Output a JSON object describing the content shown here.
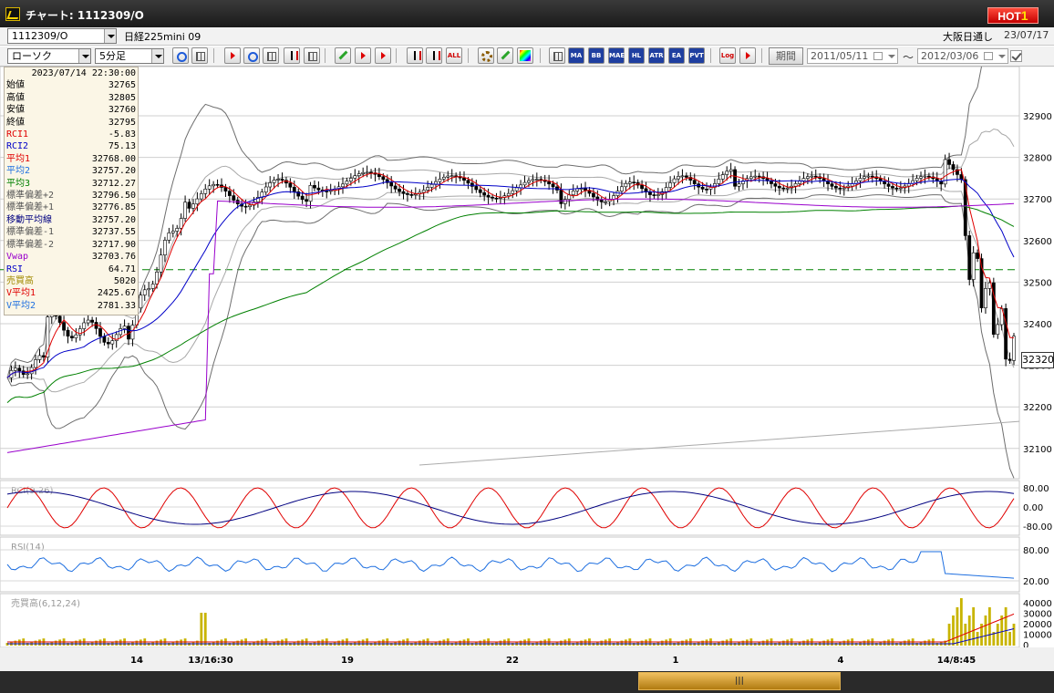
{
  "window": {
    "title": "チャート: 1112309/O",
    "hot_label": "HOT",
    "hot_num": "1"
  },
  "symbol_bar": {
    "code": "1112309/O",
    "name": "日経225mini 09",
    "exchange": "大阪日通し",
    "date": "23/07/17"
  },
  "toolbar": {
    "chart_type": "ローソク",
    "interval": "5分足",
    "buttons": [
      "MA",
      "BB",
      "MAE",
      "HL",
      "ATR",
      "EA RA",
      "PVT",
      "Log",
      "ALL"
    ],
    "period_label": "期間",
    "date_from": "2011/05/11",
    "date_to": "2012/03/06",
    "tilde": "〜"
  },
  "info_panel": {
    "timestamp": "2023/07/14 22:30:00",
    "rows": [
      {
        "label": "始値",
        "value": "32765",
        "color": "#000000"
      },
      {
        "label": "高値",
        "value": "32805",
        "color": "#000000"
      },
      {
        "label": "安値",
        "value": "32760",
        "color": "#000000"
      },
      {
        "label": "終値",
        "value": "32795",
        "color": "#000000"
      },
      {
        "label": "RCI1",
        "value": "-5.83",
        "color": "#e00000"
      },
      {
        "label": "RCI2",
        "value": "75.13",
        "color": "#0000c8"
      },
      {
        "label": "平均1",
        "value": "32768.00",
        "color": "#e00000"
      },
      {
        "label": "平均2",
        "value": "32757.20",
        "color": "#1e6fe0"
      },
      {
        "label": "平均3",
        "value": "32712.27",
        "color": "#008000"
      },
      {
        "label": "標準偏差+2",
        "value": "32796.50",
        "color": "#555555"
      },
      {
        "label": "標準偏差+1",
        "value": "32776.85",
        "color": "#555555"
      },
      {
        "label": "移動平均線",
        "value": "32757.20",
        "color": "#000080"
      },
      {
        "label": "標準偏差-1",
        "value": "32737.55",
        "color": "#555555"
      },
      {
        "label": "標準偏差-2",
        "value": "32717.90",
        "color": "#555555"
      },
      {
        "label": "Vwap",
        "value": "32703.76",
        "color": "#9900cc"
      },
      {
        "label": "RSI",
        "value": "64.71",
        "color": "#0000c8"
      },
      {
        "label": "売買高",
        "value": "5020",
        "color": "#a08a00"
      },
      {
        "label": "V平均1",
        "value": "2425.67",
        "color": "#e00000"
      },
      {
        "label": "V平均2",
        "value": "2781.33",
        "color": "#1e6fe0"
      }
    ]
  },
  "price_axis": {
    "labels": [
      "32900",
      "32800",
      "32700",
      "32600",
      "32500",
      "32400",
      "32300",
      "32200",
      "32100"
    ],
    "current": "32320"
  },
  "panels": {
    "rci": {
      "label": "RCI(9,26)",
      "ticks": [
        "80.00",
        "0.00",
        "-80.00"
      ]
    },
    "rsi": {
      "label": "RSI(14)",
      "ticks": [
        "80.00",
        "20.00"
      ]
    },
    "volume": {
      "label": "売買高(6,12,24)",
      "ticks": [
        "40000",
        "30000",
        "20000",
        "10000",
        "0"
      ]
    }
  },
  "time_axis": [
    "14",
    "13/16:30",
    "19",
    "22",
    "1",
    "4",
    "14/8:45"
  ],
  "colors": {
    "up": "#ffffff",
    "down": "#000000",
    "ma1": "#e00000",
    "ma2": "#0000c8",
    "ma3": "#008000",
    "vwap": "#9900cc",
    "bb": "#777777",
    "rci1": "#e00000",
    "rci2": "#000080",
    "rsi": "#1e6fe0",
    "vol": "#c8b400",
    "dash": "#008000"
  }
}
